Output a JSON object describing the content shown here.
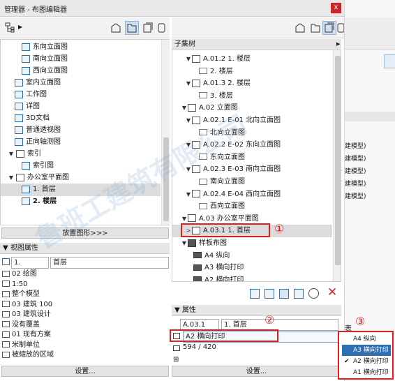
{
  "window": {
    "title": "管理器 - 布图编辑器",
    "close": "x"
  },
  "left_tree": [
    {
      "label": "东向立面图",
      "icon": "elevation-icon",
      "indent": 1,
      "type": "view"
    },
    {
      "label": "南向立面图",
      "icon": "elevation-icon",
      "indent": 1,
      "type": "view"
    },
    {
      "label": "西向立面图",
      "icon": "elevation-icon",
      "indent": 1,
      "type": "view"
    },
    {
      "label": "室内立面图",
      "icon": "interior-elevation-icon",
      "indent": 0,
      "type": "folder"
    },
    {
      "label": "工作图",
      "icon": "worksheet-icon",
      "indent": 0,
      "type": "folder"
    },
    {
      "label": "详图",
      "icon": "detail-icon",
      "indent": 0,
      "type": "folder"
    },
    {
      "label": "3D文档",
      "icon": "3d-document-icon",
      "indent": 0,
      "type": "folder"
    },
    {
      "label": "普通透视图",
      "icon": "perspective-icon",
      "indent": 0,
      "type": "folder"
    },
    {
      "label": "正向轴测图",
      "icon": "axonometric-icon",
      "indent": 0,
      "type": "folder"
    },
    {
      "label": "索引",
      "icon": "folder-icon",
      "indent": 0,
      "type": "group"
    },
    {
      "label": "索引图",
      "icon": "index-icon",
      "indent": 1,
      "type": "view"
    },
    {
      "label": "办公室平面图",
      "icon": "folder-icon",
      "indent": 0,
      "type": "group"
    },
    {
      "label": "1. 首层",
      "icon": "floor-plan-icon",
      "indent": 1,
      "type": "view",
      "selected": true
    },
    {
      "label": "2. 楼层",
      "icon": "floor-plan-icon",
      "indent": 1,
      "type": "view",
      "bold": true
    }
  ],
  "place_button": "放置图形>>>",
  "view_props": {
    "header": "视图属性",
    "id_value": "1.",
    "name_value": "首层",
    "items": [
      {
        "icon": "layer-combo-icon",
        "text": "02 绘图"
      },
      {
        "icon": "scale-icon",
        "text": "1:50"
      },
      {
        "icon": "model-view-icon",
        "text": "整个模型"
      },
      {
        "icon": "pen-set-icon",
        "text": "03 建筑 100"
      },
      {
        "icon": "model-view-options-icon",
        "text": "03 建筑设计"
      },
      {
        "icon": "override-icon",
        "text": "没有覆盖"
      },
      {
        "icon": "renovation-icon",
        "text": "01 现有方案"
      },
      {
        "icon": "dimension-icon",
        "text": "米制单位"
      },
      {
        "icon": "zoom-icon",
        "text": "被缩放的区域"
      }
    ],
    "settings_button": "设置..."
  },
  "right_tree": {
    "header": "子集树",
    "rows": [
      {
        "label": "A.01.2 1. 楼层",
        "level": 1,
        "expanded": true,
        "type": "layout"
      },
      {
        "label": "2. 楼层",
        "level": 2,
        "type": "drawing"
      },
      {
        "label": "A.01.3 2. 楼层",
        "level": 1,
        "expanded": true,
        "type": "layout"
      },
      {
        "label": "3. 楼层",
        "level": 2,
        "type": "drawing"
      },
      {
        "label": "A.02 立面图",
        "level": 0,
        "expanded": true,
        "type": "subset"
      },
      {
        "label": "A.02.1 E-01 北向立面图",
        "level": 1,
        "expanded": true,
        "type": "layout"
      },
      {
        "label": "北向立面图",
        "level": 2,
        "type": "drawing"
      },
      {
        "label": "A.02.2 E-02 东向立面图",
        "level": 1,
        "expanded": true,
        "type": "layout"
      },
      {
        "label": "东向立面图",
        "level": 2,
        "type": "drawing"
      },
      {
        "label": "A.02.3 E-03 南向立面图",
        "level": 1,
        "expanded": true,
        "type": "layout"
      },
      {
        "label": "南向立面图",
        "level": 2,
        "type": "drawing"
      },
      {
        "label": "A.02.4 E-04 西向立面图",
        "level": 1,
        "expanded": true,
        "type": "layout"
      },
      {
        "label": "西向立面图",
        "level": 2,
        "type": "drawing"
      },
      {
        "label": "A.03 办公室平面图",
        "level": 0,
        "expanded": true,
        "type": "subset"
      },
      {
        "label": "A.03.1 1. 首层",
        "level": 1,
        "expanded": false,
        "type": "layout",
        "selected": true
      },
      {
        "label": "样板布图",
        "level": 0,
        "expanded": true,
        "type": "subset"
      },
      {
        "label": "A4 纵向",
        "level": 1,
        "type": "master"
      },
      {
        "label": "A3 横向打印",
        "level": 1,
        "type": "master"
      },
      {
        "label": "A2 横向打印",
        "level": 1,
        "type": "master"
      }
    ]
  },
  "props": {
    "header": "属性",
    "id_value": "A.03.1",
    "name_value": "1. 首层",
    "master_value": "A2 横向打印",
    "size_value": "594 / 420",
    "settings_button": "设置..."
  },
  "dropdown": {
    "items": [
      {
        "label": "A4 纵向",
        "checked": false,
        "highlight": false
      },
      {
        "label": "A3 横向打印",
        "checked": false,
        "highlight": true
      },
      {
        "label": "A2 横向打印",
        "checked": true,
        "highlight": false
      },
      {
        "label": "A1 横向打印",
        "checked": false,
        "highlight": false
      }
    ]
  },
  "annotations": {
    "one": "①",
    "two": "②",
    "three": "③"
  },
  "bg_text": {
    "row_suffix_1": "建模型)",
    "row_suffix_2": "建模型)",
    "row_suffix_3": "建模型)",
    "row_suffix_4": "建模型)",
    "row_suffix_5": "建模型)",
    "biao": "表"
  },
  "watermark": "鲁班工建筑有限公司",
  "colors": {
    "highlight": "#2f6fb5",
    "annotation_red": "#e0201c",
    "close": "#c6282b"
  }
}
